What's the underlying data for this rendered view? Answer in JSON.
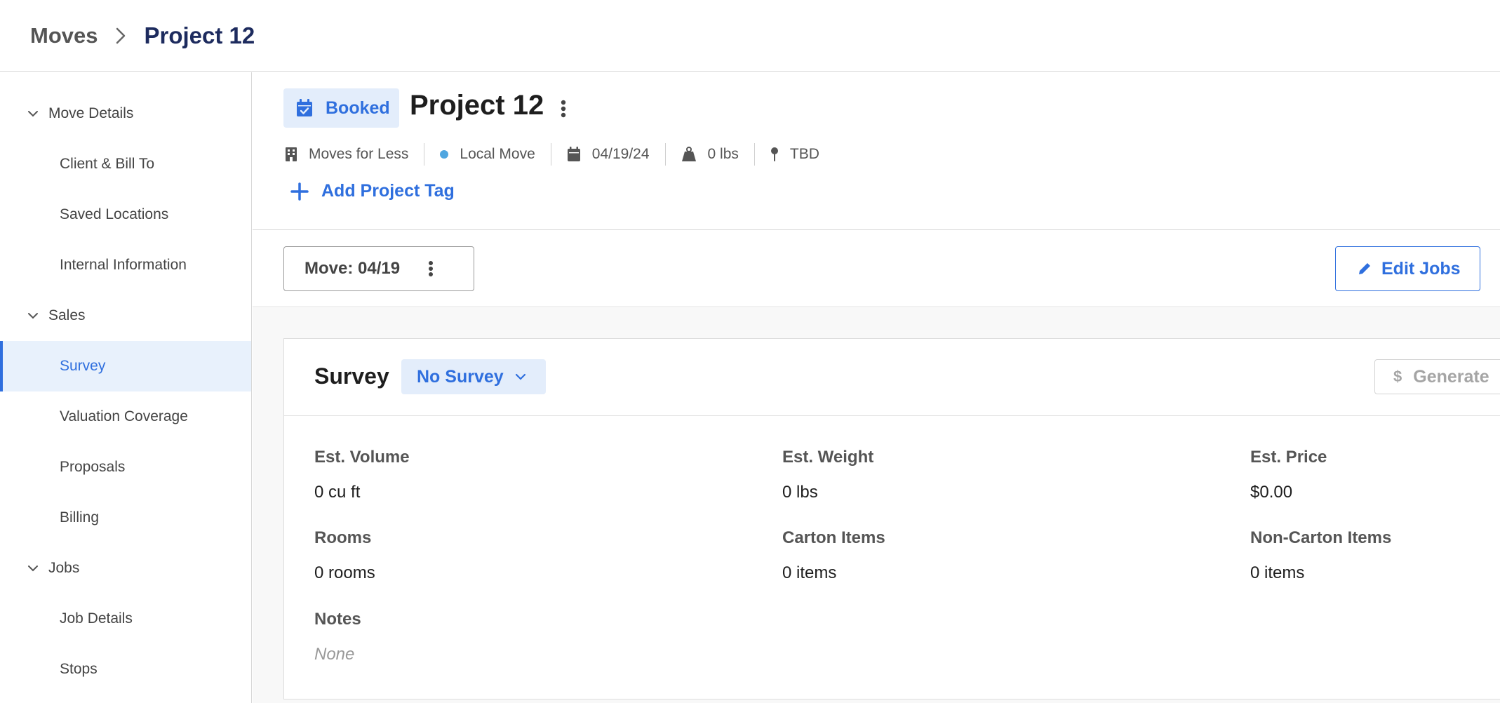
{
  "breadcrumb": {
    "root": "Moves",
    "current": "Project 12"
  },
  "sidebar": {
    "sections": [
      {
        "label": "Move Details",
        "items": [
          "Client & Bill To",
          "Saved Locations",
          "Internal Information"
        ]
      },
      {
        "label": "Sales",
        "items": [
          "Survey",
          "Valuation Coverage",
          "Proposals",
          "Billing"
        ]
      },
      {
        "label": "Jobs",
        "items": [
          "Job Details",
          "Stops"
        ]
      }
    ],
    "active_item": "Survey"
  },
  "project": {
    "status": "Booked",
    "title": "Project 12",
    "meta": {
      "company": "Moves for Less",
      "move_type": "Local Move",
      "date": "04/19/24",
      "weight": "0 lbs",
      "location": "TBD"
    },
    "add_tag_label": "Add Project Tag"
  },
  "jobs_bar": {
    "move_select_label": "Move: 04/19",
    "edit_jobs_label": "Edit Jobs"
  },
  "survey": {
    "title": "Survey",
    "dropdown_value": "No Survey",
    "generate_label": "Generate",
    "fields": {
      "est_volume": {
        "label": "Est. Volume",
        "value": "0 cu ft"
      },
      "est_weight": {
        "label": "Est. Weight",
        "value": "0 lbs"
      },
      "est_price": {
        "label": "Est. Price",
        "value": "$0.00"
      },
      "rooms": {
        "label": "Rooms",
        "value": "0 rooms"
      },
      "carton_items": {
        "label": "Carton Items",
        "value": "0 items"
      },
      "non_carton_items": {
        "label": "Non-Carton Items",
        "value": "0 items"
      },
      "notes": {
        "label": "Notes",
        "value": "None"
      }
    }
  },
  "colors": {
    "accent": "#2f6fde",
    "accent_bg": "#e3edfb",
    "title_navy": "#1d2b5e",
    "dot_blue": "#4fa6e0"
  },
  "icons": [
    "chevron-right-icon",
    "chevron-down-icon",
    "calendar-check-icon",
    "kebab-icon",
    "building-icon",
    "calendar-icon",
    "weight-icon",
    "pin-icon",
    "plus-icon",
    "pencil-icon",
    "dollar-icon"
  ]
}
